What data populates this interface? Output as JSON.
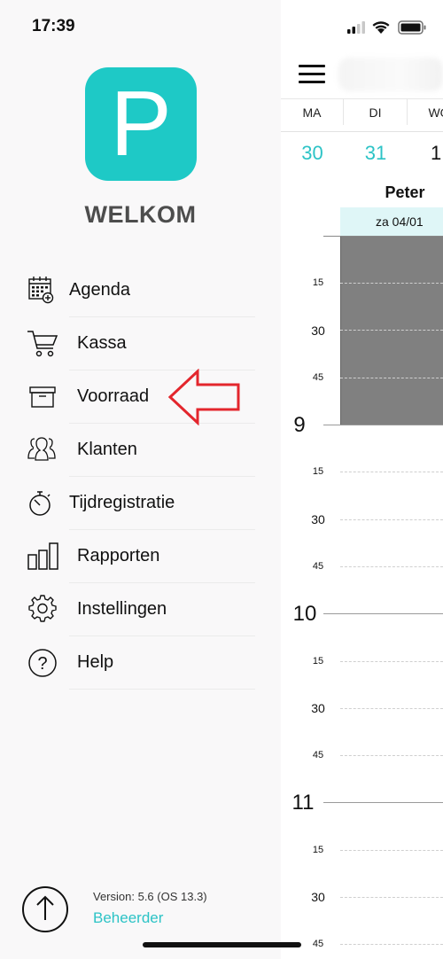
{
  "status_bar": {
    "time": "17:39",
    "icons": [
      "signal-icon",
      "wifi-icon",
      "battery-icon"
    ]
  },
  "drawer": {
    "app_icon_letter": "P",
    "welcome": "WELKOM",
    "menu": [
      {
        "key": "agenda",
        "label": "Agenda",
        "icon": "calendar-icon"
      },
      {
        "key": "kassa",
        "label": "Kassa",
        "icon": "cart-icon"
      },
      {
        "key": "voorraad",
        "label": "Voorraad",
        "icon": "box-icon"
      },
      {
        "key": "klanten",
        "label": "Klanten",
        "icon": "users-icon"
      },
      {
        "key": "tijdregistratie",
        "label": "Tijdregistratie",
        "icon": "stopwatch-icon"
      },
      {
        "key": "rapporten",
        "label": "Rapporten",
        "icon": "bar-chart-icon"
      },
      {
        "key": "instellingen",
        "label": "Instellingen",
        "icon": "gear-icon"
      },
      {
        "key": "help",
        "label": "Help",
        "icon": "help-icon"
      }
    ],
    "footer": {
      "version": "Version: 5.6 (OS 13.3)",
      "role": "Beheerder",
      "icon": "upload-icon"
    }
  },
  "calendar": {
    "day_names": [
      "MA",
      "DI",
      "WO"
    ],
    "day_numbers": [
      "30",
      "31",
      "1"
    ],
    "staff_name": "Peter",
    "column_date": "za 04/01",
    "time_labels": [
      "15",
      "30",
      "45",
      "9",
      "15",
      "30",
      "45",
      "10",
      "15",
      "30",
      "45",
      "11",
      "15",
      "30",
      "45"
    ]
  },
  "colors": {
    "accent": "#2cc3c6",
    "app_icon": "#1ec9c6",
    "blocked": "#808080",
    "date_header": "#dff6f7",
    "annotation": "#e3262d"
  }
}
